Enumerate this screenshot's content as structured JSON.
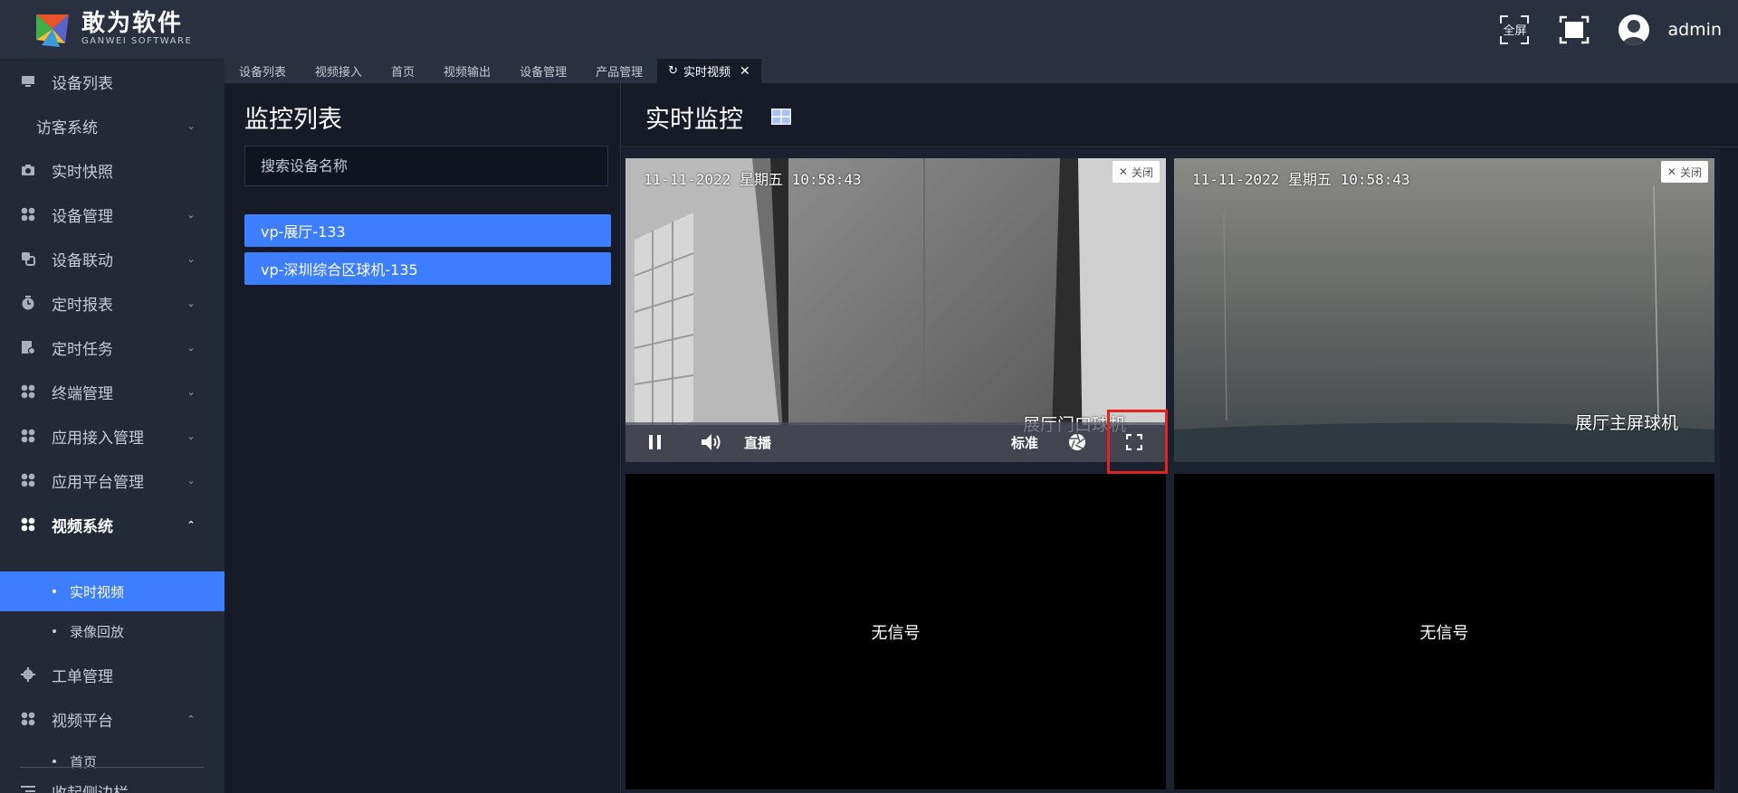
{
  "header": {
    "logo_cn": "敢为软件",
    "logo_en": "GANWEI SOFTWARE",
    "fullscreen_label": "全屏",
    "username": "admin"
  },
  "sidebar": {
    "items": [
      {
        "label": "设备列表",
        "icon": "monitor-icon",
        "chevron": false
      },
      {
        "label": "访客系统",
        "icon": "",
        "chevron": true
      },
      {
        "label": "实时快照",
        "icon": "camera-icon",
        "chevron": false
      },
      {
        "label": "设备管理",
        "icon": "grid-icon",
        "chevron": true
      },
      {
        "label": "设备联动",
        "icon": "link-icon",
        "chevron": true
      },
      {
        "label": "定时报表",
        "icon": "clock-icon",
        "chevron": true
      },
      {
        "label": "定时任务",
        "icon": "task-icon",
        "chevron": true
      },
      {
        "label": "终端管理",
        "icon": "grid-icon",
        "chevron": true
      },
      {
        "label": "应用接入管理",
        "icon": "grid-icon",
        "chevron": true
      },
      {
        "label": "应用平台管理",
        "icon": "grid-icon",
        "chevron": true
      },
      {
        "label": "视频系统",
        "icon": "grid-icon",
        "chevron": true,
        "expanded": true
      },
      {
        "label": "工单管理",
        "icon": "gear-icon",
        "chevron": false
      },
      {
        "label": "视频平台",
        "icon": "grid-icon",
        "chevron": true,
        "expanded": true
      }
    ],
    "video_sub": [
      "实时视频",
      "录像回放"
    ],
    "platform_sub": [
      "首页"
    ],
    "collapse_label": "收起侧边栏"
  },
  "tabs": {
    "items": [
      "设备列表",
      "视频接入",
      "首页",
      "视频输出",
      "设备管理",
      "产品管理"
    ],
    "active": "实时视频"
  },
  "monitor_list": {
    "title": "监控列表",
    "search_placeholder": "搜索设备名称",
    "devices": [
      "vp-展厅-133",
      "vp-深圳综合区球机-135"
    ]
  },
  "realtime": {
    "title": "实时监控",
    "cameras": [
      {
        "osd": "11-11-2022 星期五 10:58:43",
        "name": "展厅门口球机",
        "close": "关闭"
      },
      {
        "osd": "11-11-2022 星期五 10:58:43",
        "name": "展厅主屏球机",
        "close": "关闭"
      }
    ],
    "controls": {
      "live": "直播",
      "quality": "标准"
    },
    "no_signal": "无信号"
  },
  "colors": {
    "accent": "#3d7eff",
    "highlight": "#e0231c",
    "header": "#2a3040",
    "sidebar": "#232937"
  }
}
